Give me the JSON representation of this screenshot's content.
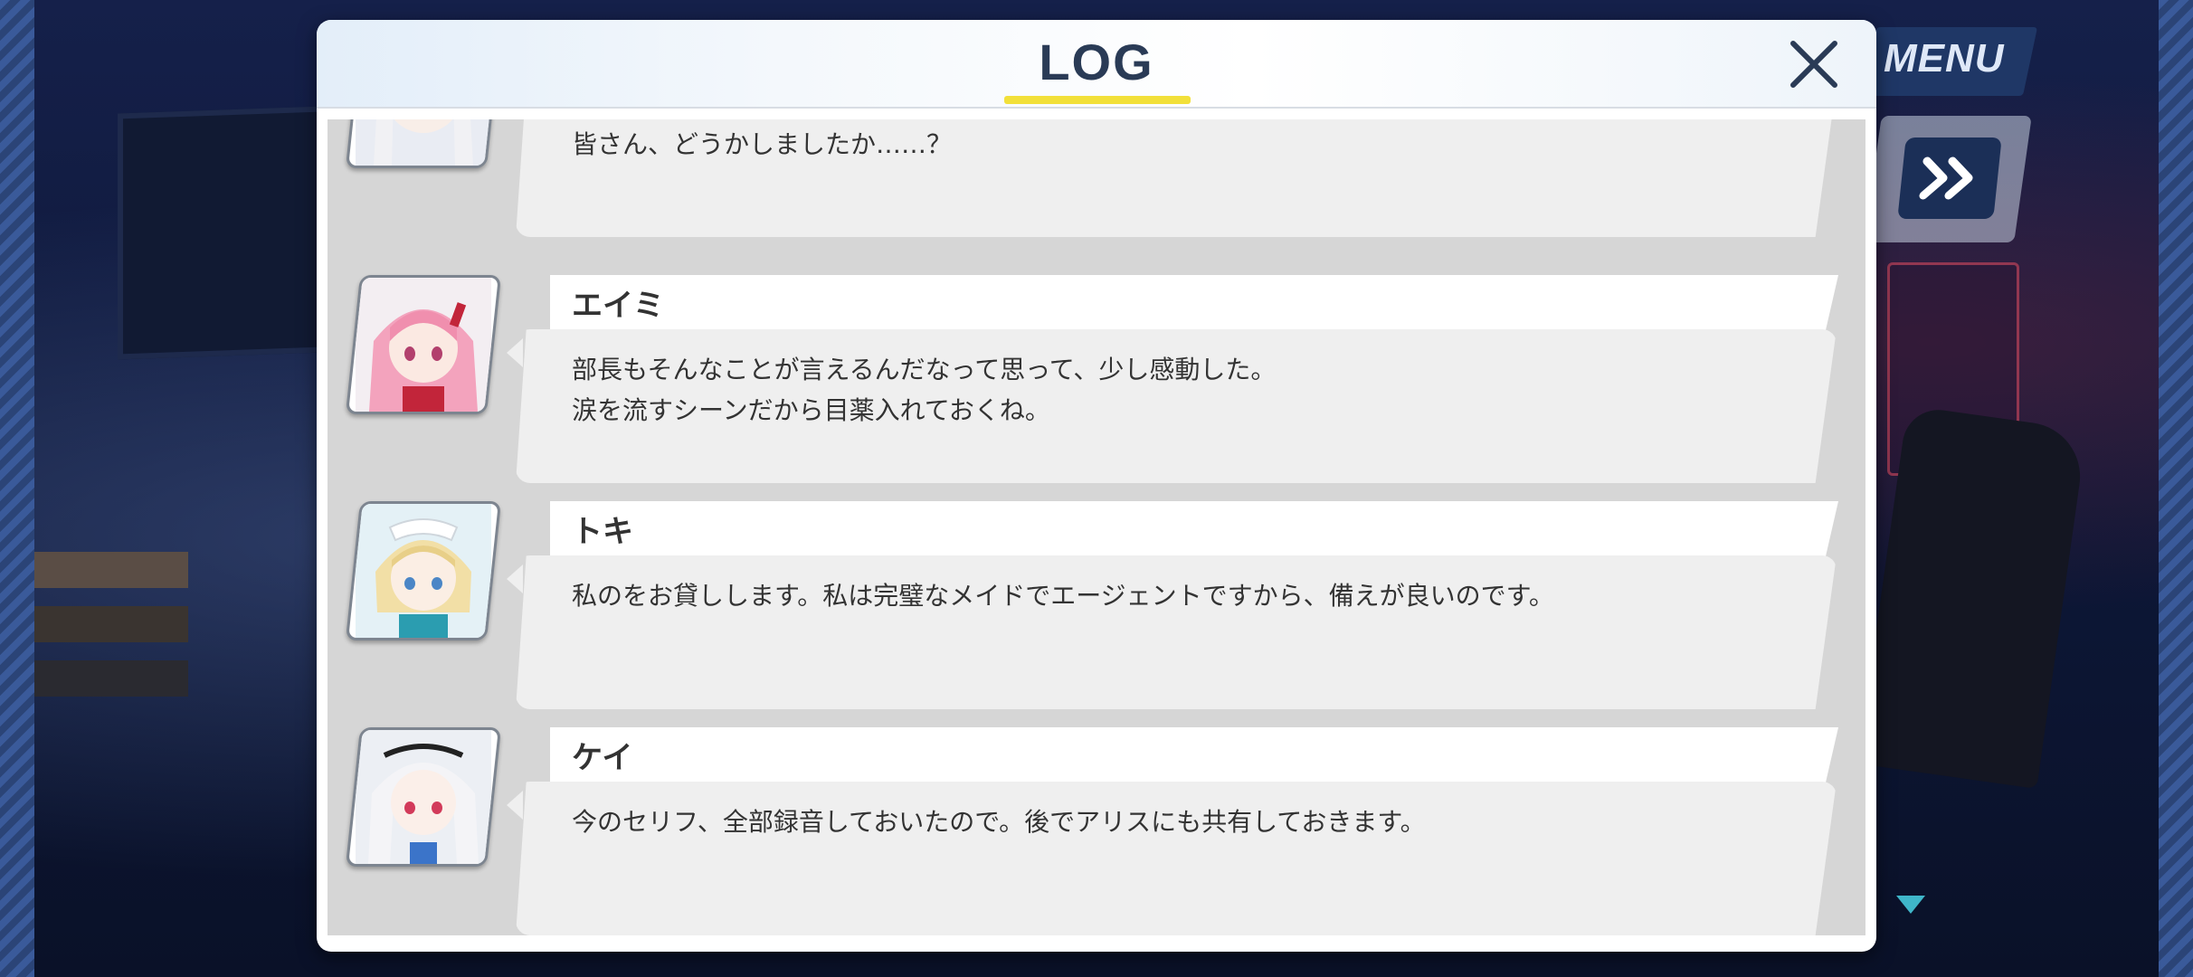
{
  "header": {
    "title": "LOG"
  },
  "hud": {
    "menu_label": "MENU",
    "skip_icon": "double-chevron-right-icon",
    "advance_icon": "triangle-down-icon"
  },
  "colors": {
    "title_underline": "#f2e03a",
    "panel_title": "#2a3b56",
    "skip_button": "#1b2f57",
    "advance_arrow": "#3fb6c9"
  },
  "entries": [
    {
      "name": "",
      "text": "皆さん、どうかしましたか……？",
      "avatar": "white-haired-girl-portrait"
    },
    {
      "name": "エイミ",
      "text": "部長もそんなことが言えるんだなって思って、少し感動した。\n涙を流すシーンだから目薬入れておくね。",
      "avatar": "pink-haired-girl-portrait"
    },
    {
      "name": "トキ",
      "text": "私のをお貸しします。私は完璧なメイドでエージェントですから、備えが良いのです。",
      "avatar": "blonde-maid-girl-portrait"
    },
    {
      "name": "ケイ",
      "text": "今のセリフ、全部録音しておいたので。後でアリスにも共有しておきます。",
      "avatar": "white-haired-red-eyed-girl-portrait"
    }
  ]
}
